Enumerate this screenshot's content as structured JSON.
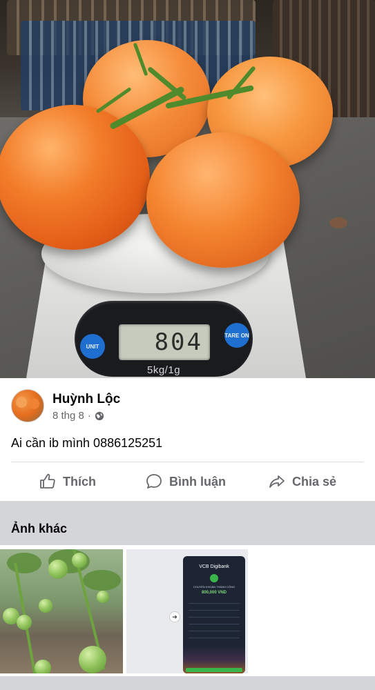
{
  "hero_photo": {
    "scale_display": "804",
    "scale_capacity": "5kg/1g",
    "scale_button_left": "UNIT",
    "scale_button_right": "TARE ON"
  },
  "post": {
    "author_name": "Huỳnh Lộc",
    "date": "8 thg 8",
    "separator": "·",
    "privacy_icon": "globe-icon",
    "text": "Ai cần ib mình 0886125251"
  },
  "actions": {
    "like_label": "Thích",
    "comment_label": "Bình luận",
    "share_label": "Chia sẻ"
  },
  "other_photos": {
    "title": "Ảnh khác",
    "phone_brand": "VCB Digibank",
    "phone_status": "CHUYỂN KHOẢN THÀNH CÔNG",
    "phone_amount": "800,000 VND"
  },
  "colors": {
    "text_primary": "#050505",
    "text_secondary": "#65676b",
    "divider": "#dadde1",
    "section_bg": "#d4d5d9"
  }
}
